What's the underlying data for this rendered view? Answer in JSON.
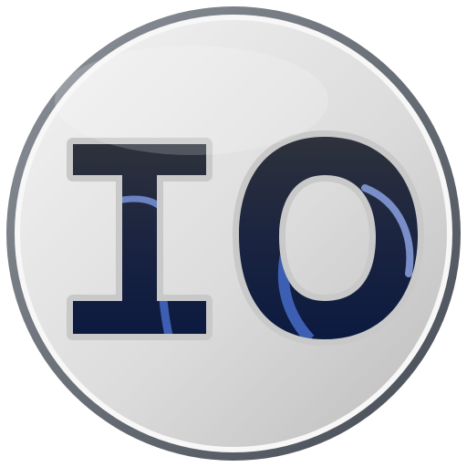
{
  "logo": {
    "text": "IO",
    "icon_name": "io-logo-icon",
    "colors": {
      "disc_light": "#f2f2f2",
      "disc_dark": "#bdbdbd",
      "rim_light": "#8a8f95",
      "rim_dark": "#4a5058",
      "letter_top": "#2b2f3a",
      "letter_bottom": "#0d1a3c",
      "letter_outline": "#cfcfcf",
      "swoosh": "#3d5fb3"
    }
  }
}
